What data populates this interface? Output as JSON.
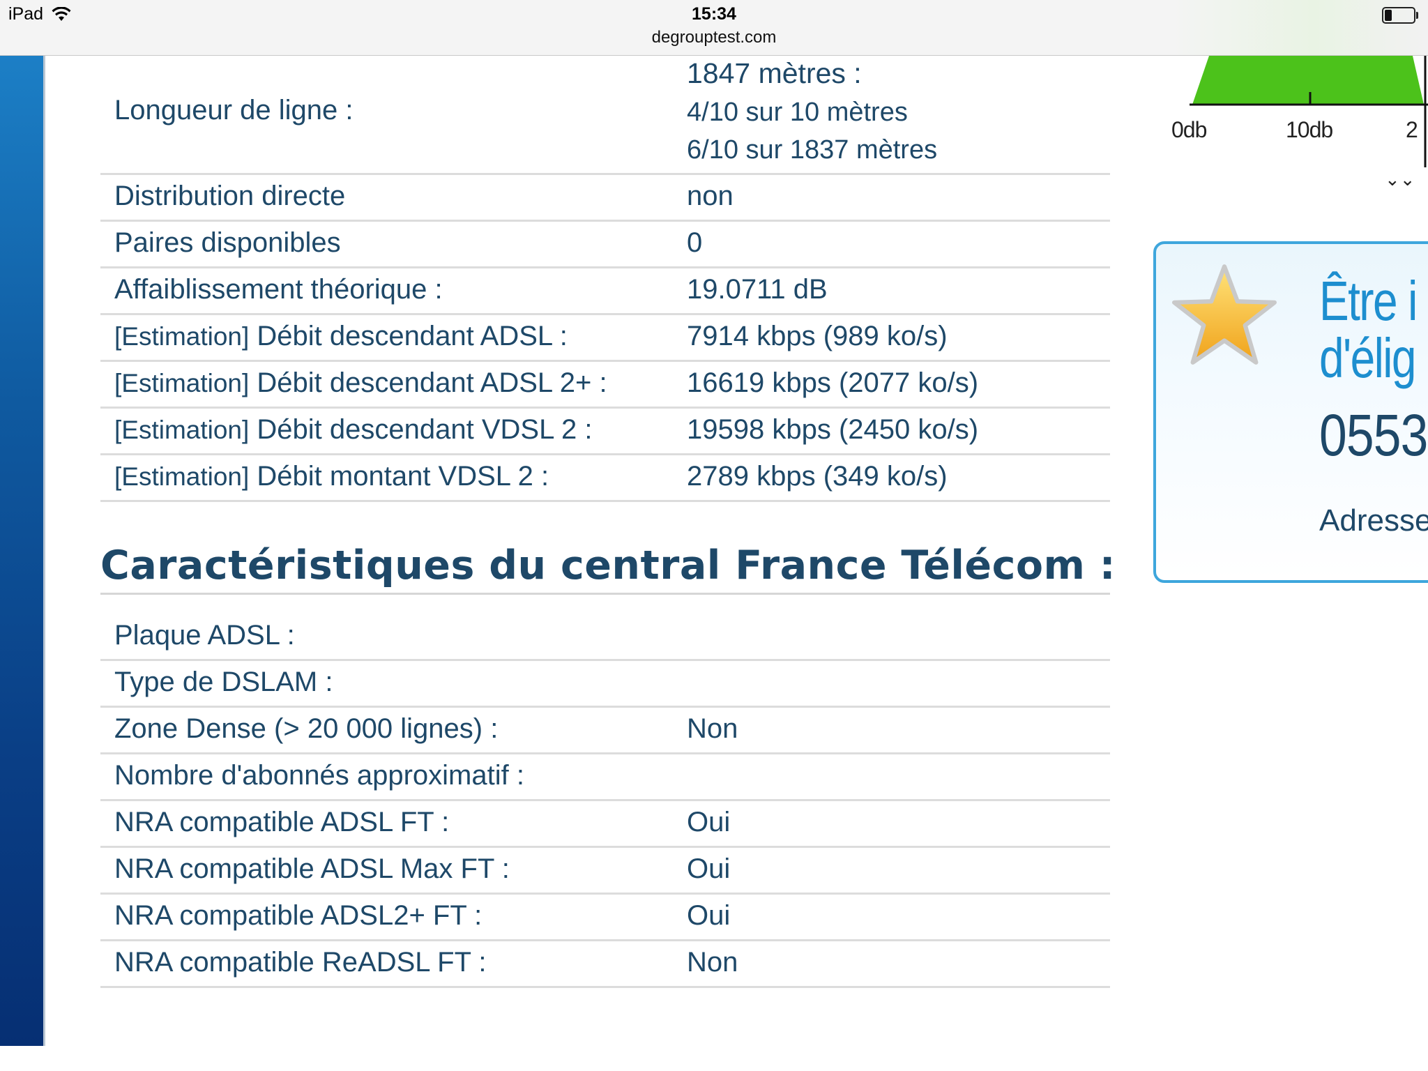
{
  "status_bar": {
    "device": "iPad",
    "time": "15:34",
    "url": "degrouptest.com"
  },
  "line_section": {
    "line_length": {
      "label": "Longueur de ligne :",
      "values": [
        "1847 mètres :",
        "4/10 sur 10 mètres",
        "6/10 sur 1837 mètres"
      ]
    },
    "rows": [
      {
        "label": "Distribution directe",
        "value": "non"
      },
      {
        "label": "Paires disponibles",
        "value": "0"
      },
      {
        "label": "Affaiblissement théorique :",
        "value": "19.0711 dB"
      }
    ],
    "estimates": [
      {
        "prefix": "[Estimation]",
        "label": " Débit descendant ADSL :",
        "value": "7914 kbps (989 ko/s)"
      },
      {
        "prefix": "[Estimation]",
        "label": " Débit descendant ADSL 2+ :",
        "value": "16619 kbps (2077 ko/s)"
      },
      {
        "prefix": "[Estimation]",
        "label": " Débit descendant VDSL 2 :",
        "value": "19598 kbps (2450 ko/s)"
      },
      {
        "prefix": "[Estimation]",
        "label": " Débit montant VDSL 2 :",
        "value": "2789 kbps (349 ko/s)"
      }
    ]
  },
  "central_section": {
    "title": "Caractéristiques du central France Télécom :",
    "rows": [
      {
        "label": "Plaque ADSL :",
        "value": ""
      },
      {
        "label": "Type de DSLAM :",
        "value": ""
      },
      {
        "label": "Zone Dense (> 20 000 lignes) :",
        "value": "Non"
      },
      {
        "label": "Nombre d'abonnés approximatif :",
        "value": ""
      },
      {
        "label": "NRA compatible ADSL FT :",
        "value": "Oui"
      },
      {
        "label": "NRA compatible ADSL Max FT :",
        "value": "Oui"
      },
      {
        "label": "NRA compatible ADSL2+ FT :",
        "value": "Oui"
      },
      {
        "label": "NRA compatible ReADSL FT :",
        "value": "Non"
      }
    ]
  },
  "attenuation_chart": {
    "ticks": [
      "0db",
      "10db",
      "2"
    ],
    "colors": {
      "fill": "#4cc21b",
      "axis": "#111111"
    }
  },
  "promo": {
    "line1": "Être i",
    "line2": "d'élig",
    "line3": "0553",
    "line4": "Adresse",
    "icon": "star-icon",
    "colors": {
      "border": "#3ea6dc",
      "title": "#1d8ecf",
      "star": "#f5b21e"
    }
  }
}
